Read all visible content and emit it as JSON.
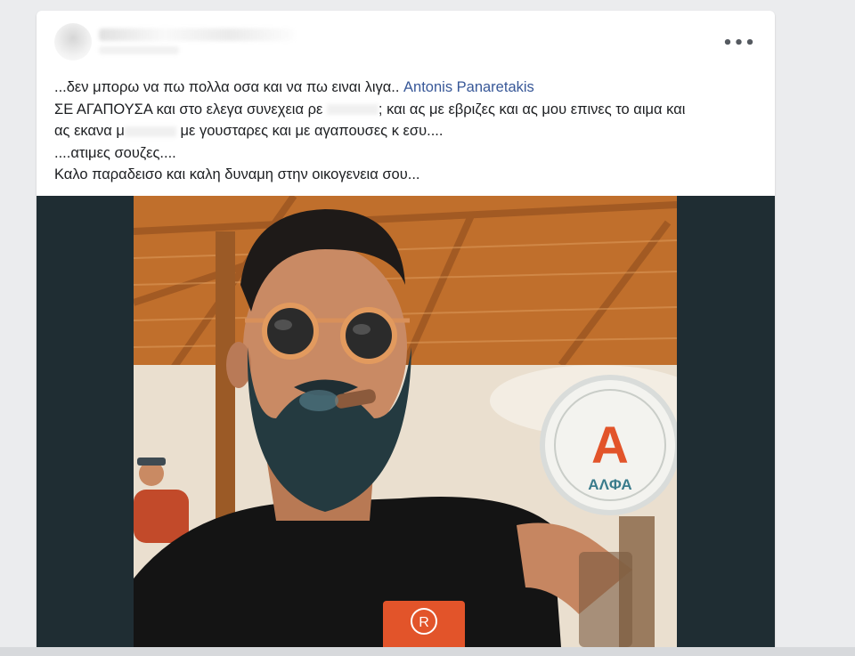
{
  "post": {
    "more_icon": "more-horizontal-icon",
    "more_label": "•••",
    "text": {
      "line1_prefix": "...δεν μπορω να πω πολλα οσα και να πω ειναι λιγα..",
      "mention": "Antonis Panaretakis",
      "line2_prefix": "ΣΕ ΑΓΑΠΟΥΣΑ και στο ελεγα συνεχεια ρε",
      "line2_suffix": "; και ας με εβριζες και ας μου επινες το αιμα και",
      "line3_prefix": "ας εκανα μ",
      "line3_suffix": "με γουσταρες και με αγαπουσες κ εσυ....",
      "line4": "....ατιμες σουζες....",
      "line5": "Καλο παραδεισο και καλη δυναμη στην οικογενεια σου..."
    },
    "photo": {
      "tap_letter": "A",
      "tap_brand": "ΑΛΦΑ",
      "shirt_mark": "R"
    }
  },
  "colors": {
    "mention": "#385898",
    "media_background": "#1f2d33",
    "page_background": "#ebecee",
    "brand_red": "#e2542a"
  }
}
